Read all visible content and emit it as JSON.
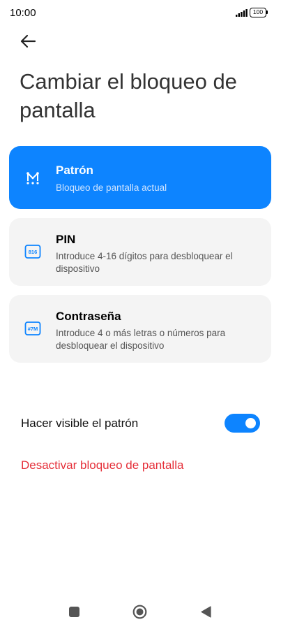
{
  "status_bar": {
    "time": "10:00",
    "battery": "100",
    "signal_icon": "signal-icon",
    "battery_icon": "battery-icon"
  },
  "header": {
    "back_icon": "back-arrow-icon",
    "title": "Cambiar el bloqueo de pantalla"
  },
  "options": [
    {
      "icon": "pattern-icon",
      "title": "Patrón",
      "description": "Bloqueo de pantalla actual",
      "selected": true
    },
    {
      "icon": "pin-icon",
      "icon_text": "816",
      "title": "PIN",
      "description": "Introduce 4-16 dígitos para desbloquear el dispositivo",
      "selected": false
    },
    {
      "icon": "password-icon",
      "icon_text": "#7M",
      "title": "Contraseña",
      "description": "Introduce 4 o más letras o números para desbloquear el dispositivo",
      "selected": false
    }
  ],
  "visible_pattern": {
    "label": "Hacer visible el patrón",
    "enabled": true
  },
  "disable_lock": {
    "label": "Desactivar bloqueo de pantalla"
  },
  "nav_bar": {
    "recents_icon": "square-icon",
    "home_icon": "home-circle-icon",
    "back_icon": "back-triangle-icon"
  },
  "colors": {
    "accent": "#0d84ff",
    "danger": "#e5303a",
    "card_bg": "#f4f4f4"
  }
}
